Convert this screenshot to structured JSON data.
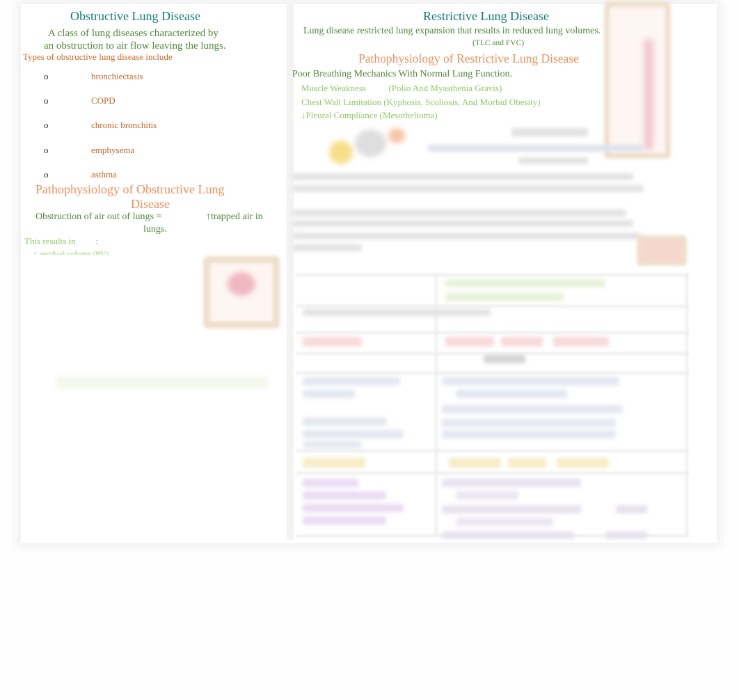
{
  "obstructive": {
    "title": "Obstructive Lung Disease",
    "definition_line1": "A class of lung diseases characterized by",
    "definition_line2": "an obstruction to air flow leaving the lungs.",
    "types_intro": "Types of obstructive lung disease include",
    "types": [
      {
        "bullet": "o",
        "label": "bronchiectasis"
      },
      {
        "bullet": "o",
        "label": "COPD"
      },
      {
        "bullet": "o",
        "label": "chronic bronchitis"
      },
      {
        "bullet": "o",
        "label": "emphysema"
      },
      {
        "bullet": "o",
        "label": "asthma"
      }
    ],
    "patho_title_line1": "Pathophysiology of Obstructive Lung",
    "patho_title_line2": "Disease",
    "patho_text_part1": "Obstruction of air out of lungs =",
    "patho_text_part2": "↑trapped air in",
    "patho_text_line2": "lungs.",
    "results_label": "This results in",
    "results_colon": ":",
    "results_item_partial": "↑ residual volume (RV)"
  },
  "restrictive": {
    "title": "Restrictive Lung Disease",
    "definition": "Lung disease restricted lung expansion that results in reduced lung volumes.",
    "definition_note": "(TLC and FVC)",
    "patho_title": "Pathophysiology of Restrictive Lung Disease",
    "patho_intro": "Poor Breathing Mechanics With Normal Lung Function.",
    "causes": [
      {
        "label": "Muscle Weakness",
        "examples": "(Polio And Myasthenia Gravis)"
      },
      {
        "label": "Chest Wall Limitation",
        "examples": "(Kyphosis, Scoliosis, And Morbid Obesity)"
      },
      {
        "label": "↓Pleural Compliance",
        "examples": "(Mesothelioma)"
      }
    ]
  },
  "colors": {
    "heading_teal": "#137a75",
    "body_green": "#4f8a3a",
    "light_green": "#8ccb63",
    "list_orange": "#c8662a",
    "subhead_salmon": "#f0915d"
  }
}
